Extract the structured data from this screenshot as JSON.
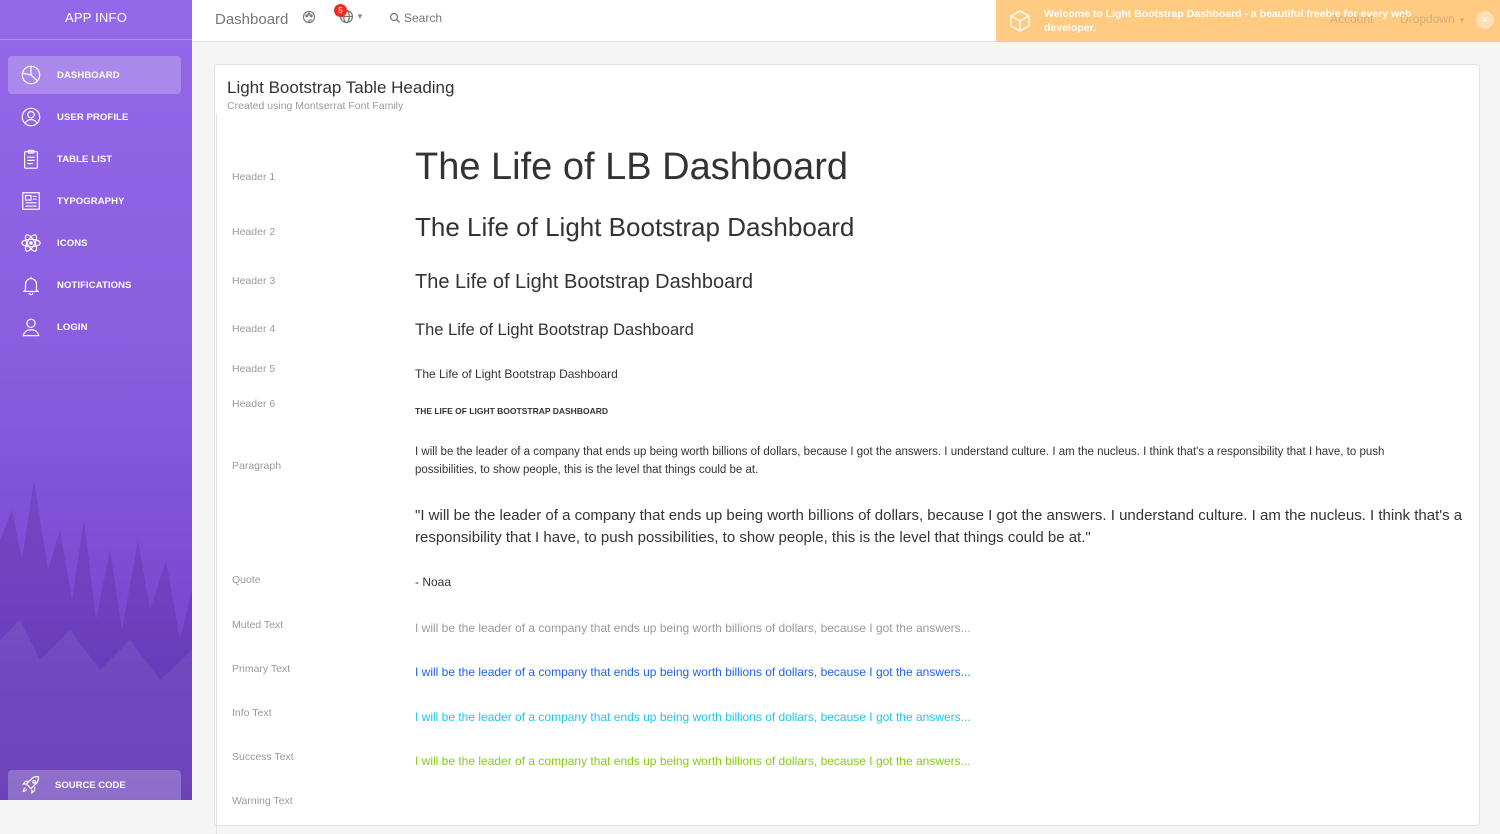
{
  "app": {
    "brand": "APP INFO"
  },
  "sidebar": {
    "items": [
      {
        "label": "DASHBOARD",
        "icon": "pie-chart-icon",
        "active": true
      },
      {
        "label": "USER PROFILE",
        "icon": "user-circle-icon",
        "active": false
      },
      {
        "label": "TABLE LIST",
        "icon": "clipboard-icon",
        "active": false
      },
      {
        "label": "TYPOGRAPHY",
        "icon": "news-paper-icon",
        "active": false
      },
      {
        "label": "ICONS",
        "icon": "atom-icon",
        "active": false
      },
      {
        "label": "NOTIFICATIONS",
        "icon": "bell-icon",
        "active": false
      },
      {
        "label": "LOGIN",
        "icon": "user-icon",
        "active": false
      }
    ],
    "source_code": {
      "label": "SOURCE CODE",
      "icon": "rocket-icon"
    },
    "gradient_top": "#9368E9",
    "gradient_bottom": "#6a3bc4"
  },
  "navbar": {
    "title": "Dashboard",
    "notification_count": "5",
    "search_label": "Search",
    "account_label": "Account",
    "dropdown_label": "Dropdown"
  },
  "toast": {
    "message": "Welcome to Light Bootstrap Dashboard - a beautiful freebie for every web developer.",
    "close_label": "×",
    "color": "#ffc574"
  },
  "card": {
    "title": "Light Bootstrap Table Heading",
    "subtitle": "Created using Montserrat Font Family",
    "rows": {
      "header1": {
        "label": "Header 1",
        "value": "The Life of LB Dashboard"
      },
      "header2": {
        "label": "Header 2",
        "value": "The Life of Light Bootstrap Dashboard"
      },
      "header3": {
        "label": "Header 3",
        "value": "The Life of Light Bootstrap Dashboard"
      },
      "header4": {
        "label": "Header 4",
        "value": "The Life of Light Bootstrap Dashboard"
      },
      "header5": {
        "label": "Header 5",
        "value": "The Life of Light Bootstrap Dashboard"
      },
      "header6": {
        "label": "Header 6",
        "value": "The Life of Light Bootstrap Dashboard"
      },
      "paragraph": {
        "label": "Paragraph",
        "value": "I will be the leader of a company that ends up being worth billions of dollars, because I got the answers. I understand culture. I am the nucleus. I think that's a responsibility that I have, to push possibilities, to show people, this is the level that things could be at."
      },
      "quote": {
        "label": "Quote",
        "value": "\"I will be the leader of a company that ends up being worth billions of dollars, because I got the answers. I understand culture. I am the nucleus. I think that's a responsibility that I have, to push possibilities, to show people, this is the level that things could be at.\"",
        "author": "- Noaa"
      },
      "muted": {
        "label": "Muted Text",
        "value": "I will be the leader of a company that ends up being worth billions of dollars, because I got the answers...",
        "color": "#9a9a9a"
      },
      "primary": {
        "label": "Primary Text",
        "value": "I will be the leader of a company that ends up being worth billions of dollars, because I got the answers...",
        "color": "#1d62f0"
      },
      "info": {
        "label": "Info Text",
        "value": "I will be the leader of a company that ends up being worth billions of dollars, because I got the answers...",
        "color": "#1dc7ea"
      },
      "success": {
        "label": "Success Text",
        "value": "I will be the leader of a company that ends up being worth billions of dollars, because I got the answers...",
        "color": "#87cb16"
      },
      "warning": {
        "label": "Warning Text"
      }
    }
  }
}
